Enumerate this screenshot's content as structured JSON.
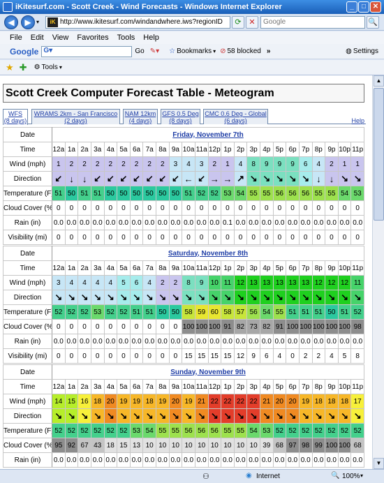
{
  "window": {
    "title": "iKitesurf.com - Scott Creek - Wind Forecasts - Windows Internet Explorer"
  },
  "address": {
    "url": "http://www.ikitesurf.com/windandwhere.iws?regionID",
    "search_placeholder": "Google"
  },
  "menu": [
    "File",
    "Edit",
    "View",
    "Favorites",
    "Tools",
    "Help"
  ],
  "google_bar": {
    "logo": "Google",
    "go": "Go",
    "bookmarks": "Bookmarks",
    "blocked": "58 blocked",
    "settings": "Settings"
  },
  "fav_bar": {
    "tools": "Tools"
  },
  "page": {
    "title": "Scott Creek Computer Forecast Table - Meteogram",
    "help": "Help"
  },
  "tabs": [
    {
      "line1": "WFS",
      "line2": "(8 days)"
    },
    {
      "line1": "WRAMS 2km - San Francisco",
      "line2": "(2 days)"
    },
    {
      "line1": "NAM 12km",
      "line2": "(4 days)"
    },
    {
      "line1": "GFS 0.5 Deg",
      "line2": "(8 days)"
    },
    {
      "line1": "CMC 0.6 Deg - Global",
      "line2": "(6 days)"
    }
  ],
  "row_labels": {
    "date": "Date",
    "time": "Time",
    "wind": "Wind (mph)",
    "direction": "Direction",
    "temperature": "Temperature (F)",
    "cloud": "Cloud Cover (%)",
    "rain": "Rain (in)",
    "visibility": "Visibility (mi)"
  },
  "times": [
    "12a",
    "1a",
    "2a",
    "3a",
    "4a",
    "5a",
    "6a",
    "7a",
    "8a",
    "9a",
    "10a",
    "11a",
    "12p",
    "1p",
    "2p",
    "3p",
    "4p",
    "5p",
    "6p",
    "7p",
    "8p",
    "9p",
    "10p",
    "11p"
  ],
  "days": [
    {
      "name": "Friday, November 7th",
      "wind": [
        1,
        2,
        2,
        2,
        2,
        2,
        2,
        2,
        2,
        3,
        4,
        3,
        2,
        1,
        4,
        8,
        9,
        9,
        9,
        6,
        4,
        2,
        1,
        1
      ],
      "dir": [
        "↙",
        "↓",
        "↓",
        "↙",
        "↙",
        "↙",
        "↙",
        "↙",
        "↙",
        "↙",
        "←",
        "↙",
        "→",
        "→",
        "↗",
        "↘",
        "↘",
        "↘",
        "↘",
        "↘",
        "↓",
        "↓",
        "↘",
        "↘"
      ],
      "temp": [
        51,
        50,
        51,
        51,
        50,
        50,
        50,
        50,
        50,
        50,
        51,
        52,
        52,
        53,
        54,
        55,
        55,
        56,
        56,
        56,
        55,
        55,
        54,
        53
      ],
      "cloud": [
        0,
        0,
        0,
        0,
        0,
        0,
        0,
        0,
        0,
        0,
        0,
        0,
        0,
        0,
        0,
        0,
        0,
        0,
        0,
        0,
        0,
        0,
        0,
        0
      ],
      "rain": [
        "0.0",
        "0.0",
        "0.0",
        "0.0",
        "0.0",
        "0.0",
        "0.0",
        "0.0",
        "0.0",
        "0.0",
        "0.0",
        "0.0",
        "0.0",
        "0.1",
        "0.0",
        "0.0",
        "0.0",
        "0.0",
        "0.0",
        "0.0",
        "0.0",
        "0.0",
        "0.0",
        "0.0"
      ],
      "vis": [
        0,
        0,
        0,
        0,
        0,
        0,
        0,
        0,
        0,
        0,
        0,
        0,
        0,
        0,
        0,
        0,
        0,
        0,
        0,
        0,
        0,
        0,
        0,
        0
      ]
    },
    {
      "name": "Saturday, November 8th",
      "wind": [
        3,
        4,
        4,
        4,
        4,
        5,
        6,
        4,
        2,
        2,
        8,
        9,
        10,
        11,
        12,
        13,
        13,
        13,
        13,
        13,
        12,
        12,
        12,
        11
      ],
      "dir": [
        "↘",
        "↘",
        "↘",
        "↘",
        "↘",
        "↘",
        "↘",
        "↘",
        "↘",
        "↘",
        "↘",
        "↘",
        "↘",
        "↘",
        "↘",
        "↘",
        "↘",
        "↘",
        "↘",
        "↘",
        "↘",
        "↘",
        "↘",
        "↘"
      ],
      "temp": [
        52,
        52,
        52,
        53,
        52,
        52,
        51,
        51,
        50,
        50,
        58,
        59,
        60,
        58,
        57,
        56,
        54,
        55,
        51,
        51,
        51,
        50,
        51,
        52
      ],
      "cloud": [
        0,
        0,
        0,
        0,
        0,
        0,
        0,
        0,
        0,
        0,
        100,
        100,
        100,
        91,
        82,
        73,
        82,
        91,
        100,
        100,
        100,
        100,
        100,
        98
      ],
      "rain": [
        "0.0",
        "0.0",
        "0.0",
        "0.0",
        "0.0",
        "0.0",
        "0.0",
        "0.0",
        "0.0",
        "0.0",
        "0.0",
        "0.0",
        "0.0",
        "0.0",
        "0.0",
        "0.0",
        "0.0",
        "0.0",
        "0.0",
        "0.0",
        "0.0",
        "0.0",
        "0.0",
        "0.0"
      ],
      "vis": [
        0,
        0,
        0,
        0,
        0,
        0,
        0,
        0,
        0,
        0,
        15,
        15,
        15,
        15,
        12,
        9,
        6,
        4,
        0,
        2,
        2,
        4,
        5,
        8
      ]
    },
    {
      "name": "Sunday, November 9th",
      "wind": [
        14,
        15,
        16,
        18,
        20,
        19,
        19,
        18,
        19,
        20,
        19,
        21,
        22,
        22,
        22,
        22,
        21,
        20,
        20,
        19,
        18,
        18,
        18,
        17
      ],
      "dir": [
        "↘",
        "↘",
        "↘",
        "↘",
        "↘",
        "↘",
        "↘",
        "↘",
        "↘",
        "↘",
        "↘",
        "↘",
        "↘",
        "↘",
        "↘",
        "↘",
        "↘",
        "↘",
        "↘",
        "↘",
        "↘",
        "↘",
        "↘",
        "↘"
      ],
      "temp": [
        52,
        52,
        52,
        52,
        52,
        52,
        53,
        54,
        55,
        55,
        56,
        56,
        56,
        55,
        55,
        54,
        53,
        52,
        52,
        52,
        52,
        52,
        52,
        52
      ],
      "cloud": [
        95,
        92,
        67,
        43,
        18,
        15,
        13,
        10,
        10,
        10,
        10,
        10,
        10,
        10,
        10,
        10,
        39,
        68,
        97,
        98,
        99,
        100,
        100,
        68
      ],
      "rain": [
        "0.0",
        "0.0",
        "0.0",
        "0.0",
        "0.0",
        "0.0",
        "0.0",
        "0.0",
        "0.0",
        "0.0",
        "0.0",
        "0.0",
        "0.0",
        "0.0",
        "0.0",
        "0.0",
        "0.0",
        "0.0",
        "0.0",
        "0.0",
        "0.0",
        "0.0",
        "0.0",
        "0.0"
      ],
      "vis": []
    }
  ],
  "status": {
    "zone": "Internet",
    "zoom": "100%"
  },
  "colors": {
    "tab_link": "#1f3ea6",
    "titlebar": "#1a5fb8"
  }
}
